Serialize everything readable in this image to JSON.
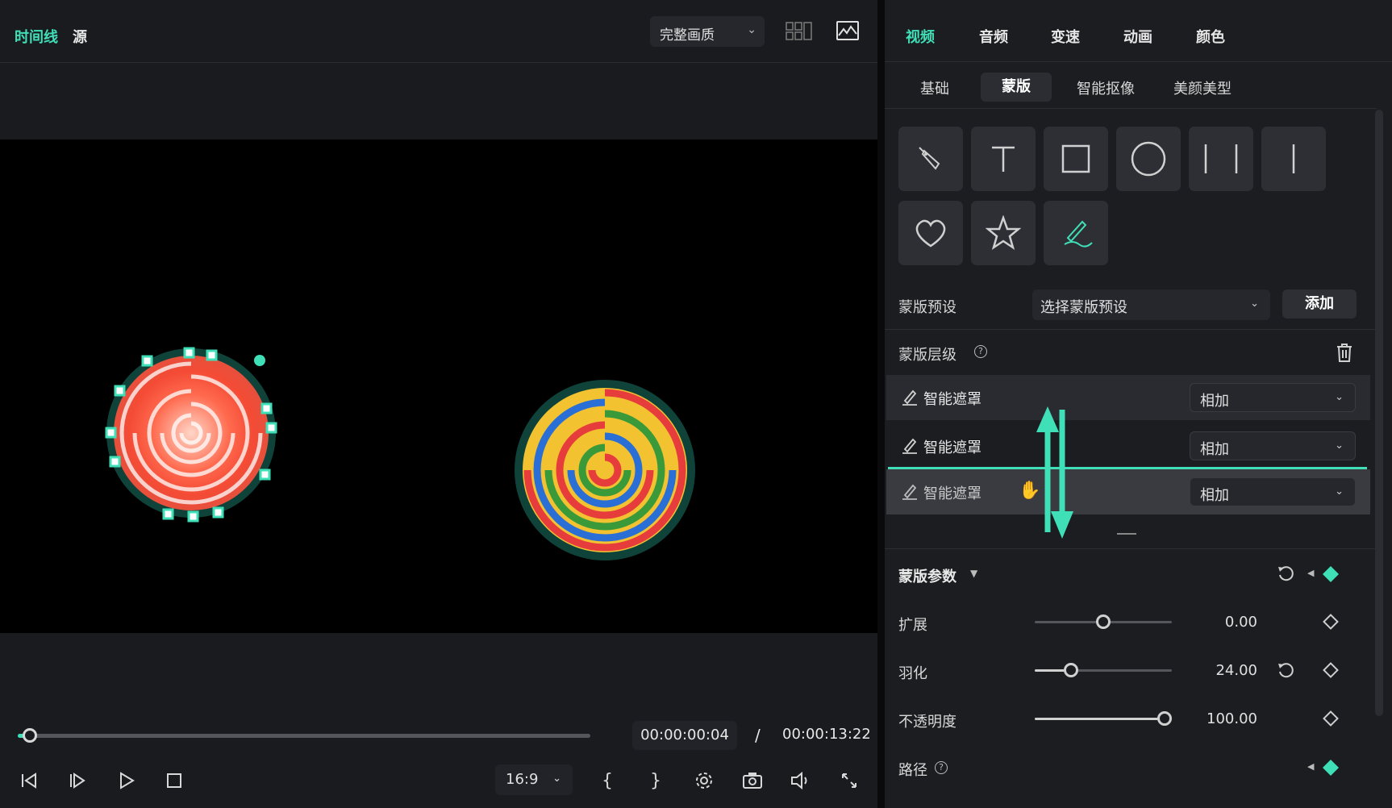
{
  "left_panel": {
    "tabs": [
      "时间线",
      "源"
    ],
    "quality_select": "完整画质",
    "playback": {
      "current_time": "00:00:00:04",
      "separator": "/",
      "total_time": "00:00:13:22",
      "progress_fraction": 0.01
    },
    "ratio_select": "16:9",
    "controls": [
      "previous-frame-icon",
      "next-frame-icon",
      "play-icon",
      "stop-icon",
      "mark-in-icon",
      "mark-out-icon",
      "settings-icon",
      "snapshot-icon",
      "volume-icon",
      "fullscreen-icon"
    ]
  },
  "right_panel": {
    "main_tabs": [
      "视频",
      "音频",
      "变速",
      "动画",
      "颜色"
    ],
    "sub_tabs": [
      "基础",
      "蒙版",
      "智能抠像",
      "美颜美型"
    ],
    "shapes": [
      "pen-icon",
      "text-icon",
      "rectangle-icon",
      "circle-icon",
      "double-line-icon",
      "single-line-icon",
      "heart-icon",
      "star-icon",
      "smart-brush-icon"
    ],
    "mask_preset": {
      "label": "蒙版预设",
      "select_value": "选择蒙版预设",
      "add_button": "添加"
    },
    "mask_layers": {
      "label": "蒙版层级",
      "layers": [
        {
          "name": "智能遮罩",
          "blend": "相加"
        },
        {
          "name": "智能遮罩",
          "blend": "相加"
        },
        {
          "name": "智能遮罩",
          "blend": "相加"
        }
      ]
    },
    "mask_params": {
      "label": "蒙版参数",
      "params": [
        {
          "label": "扩展",
          "value": "0.00",
          "level": 0.5
        },
        {
          "label": "羽化",
          "value": "24.00",
          "level": 0.26
        },
        {
          "label": "不透明度",
          "value": "100.00",
          "level": 1.0
        }
      ],
      "path_label": "路径"
    }
  },
  "colors": {
    "accent": "#3fe0b8",
    "background": "#1c1d21"
  }
}
